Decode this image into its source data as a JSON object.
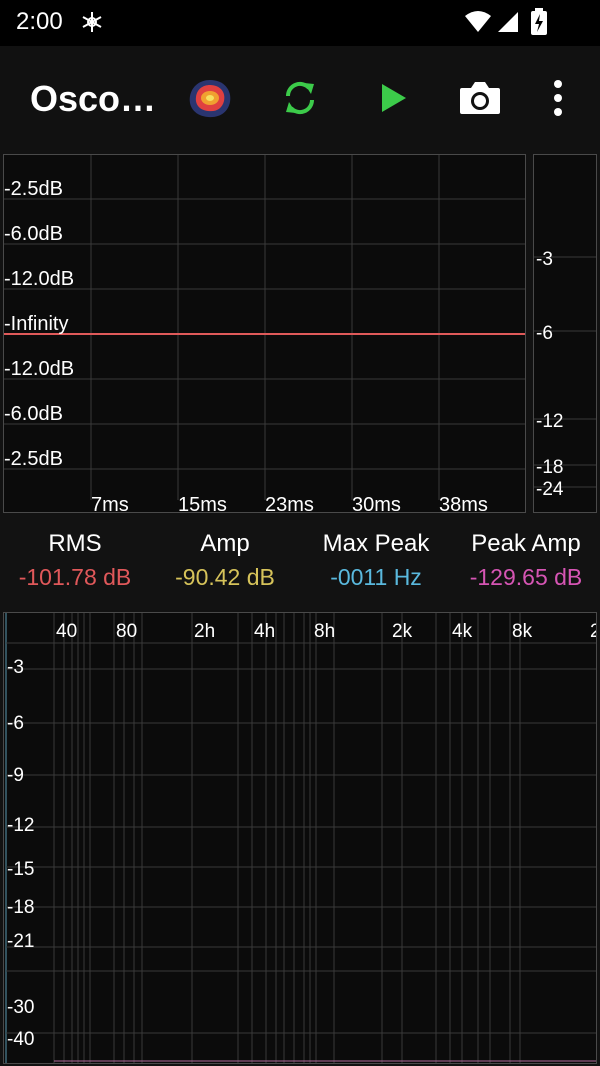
{
  "status": {
    "time": "2:00"
  },
  "toolbar": {
    "title": "Osco…",
    "colors": {
      "play": "#3ccb4a",
      "sync": "#3ccb4a"
    }
  },
  "waveform": {
    "y_labels": [
      "-2.5dB",
      "-6.0dB",
      "-12.0dB",
      "-Infinity",
      "-12.0dB",
      "-6.0dB",
      "-2.5dB"
    ],
    "x_labels": [
      "7ms",
      "15ms",
      "23ms",
      "30ms",
      "38ms"
    ],
    "trace_color": "#e05a5a"
  },
  "meter": {
    "labels": [
      "-3",
      "-6",
      "-12",
      "-18",
      "-24"
    ]
  },
  "readouts": [
    {
      "label": "RMS",
      "value": "-101.78 dB",
      "color": "#e0585a"
    },
    {
      "label": "Amp",
      "value": "-90.42 dB",
      "color": "#d6c35a"
    },
    {
      "label": "Max Peak",
      "value": "-0011 Hz",
      "color": "#5ab9de"
    },
    {
      "label": "Peak Amp",
      "value": "-129.65 dB",
      "color": "#d655b4"
    }
  ],
  "spectrum": {
    "x_labels": [
      "40",
      "80",
      "2h",
      "4h",
      "8h",
      "2k",
      "4k",
      "8k",
      "2"
    ],
    "y_labels": [
      "-3",
      "-6",
      "-9",
      "-12",
      "-15",
      "-18",
      "-21",
      "-30",
      "-40"
    ]
  }
}
